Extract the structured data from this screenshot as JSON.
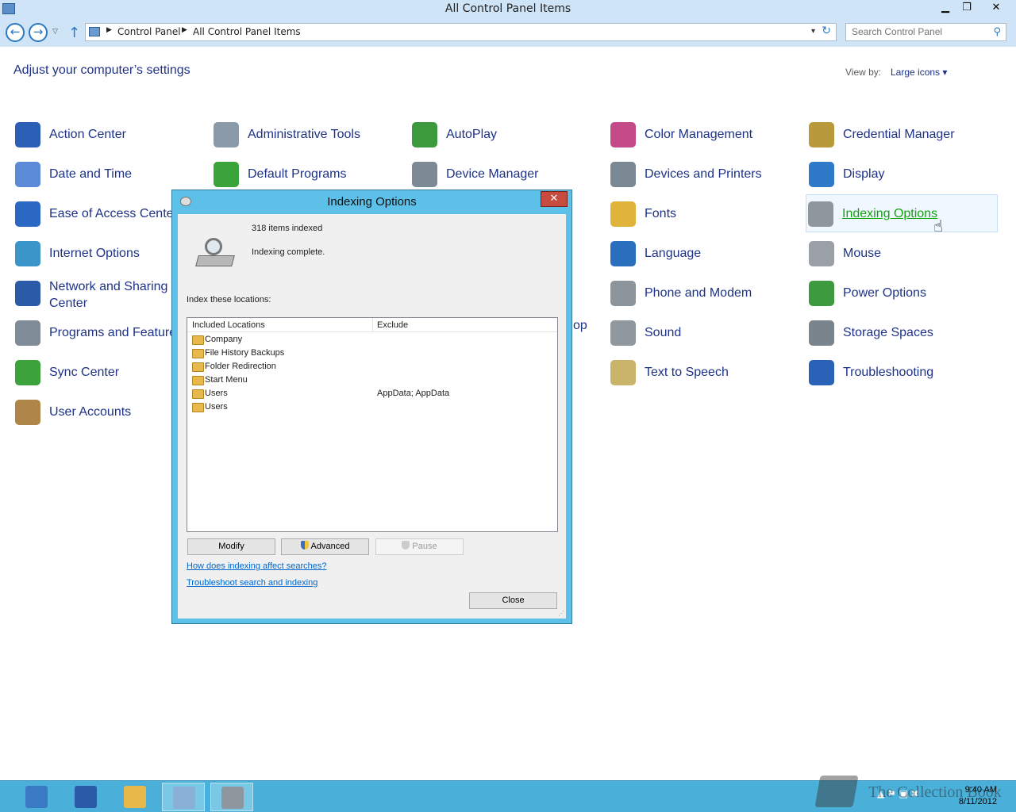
{
  "window": {
    "title": "All Control Panel Items",
    "min_glyph": "▁",
    "max_glyph": "❐",
    "close_glyph": "✕"
  },
  "nav": {
    "back_glyph": "←",
    "forward_glyph": "→",
    "recent_glyph": "▽",
    "up_glyph": "↑",
    "breadcrumb": [
      "Control Panel",
      "All Control Panel Items"
    ],
    "sep_glyph": "▶",
    "dropdown_glyph": "▾",
    "refresh_glyph": "↻",
    "search_placeholder": "Search Control Panel",
    "search_glyph": "⚲"
  },
  "header": {
    "title": "Adjust your computer’s settings",
    "view_by_label": "View by:",
    "view_by_value": "Large icons ▾"
  },
  "items": [
    {
      "label": "Action Center",
      "icon": "flag-icon",
      "color": "#2a5fb5"
    },
    {
      "label": "Administrative Tools",
      "icon": "gear-icon",
      "color": "#8a9aa8"
    },
    {
      "label": "AutoPlay",
      "icon": "autoplay-icon",
      "color": "#3c9a3c"
    },
    {
      "label": "Color Management",
      "icon": "color-icon",
      "color": "#c44a8a"
    },
    {
      "label": "Credential Manager",
      "icon": "vault-icon",
      "color": "#b89a3a"
    },
    {
      "label": "Date and Time",
      "icon": "calendar-icon",
      "color": "#5a8ad8"
    },
    {
      "label": "Default Programs",
      "icon": "default-programs-icon",
      "color": "#3aa33a"
    },
    {
      "label": "Device Manager",
      "icon": "device-manager-icon",
      "color": "#7d8a96"
    },
    {
      "label": "Devices and Printers",
      "icon": "printer-icon",
      "color": "#7a8894"
    },
    {
      "label": "Display",
      "icon": "monitor-icon",
      "color": "#2f79c9"
    },
    {
      "label": "Ease of Access Center",
      "icon": "accessibility-icon",
      "color": "#2a68c4"
    },
    {
      "label": "Fonts",
      "icon": "fonts-icon",
      "color": "#e0b33a"
    },
    {
      "label": "Indexing Options",
      "icon": "indexing-icon",
      "color": "#8e979e"
    },
    {
      "label": "Internet Options",
      "icon": "globe-icon",
      "color": "#3a95c9"
    },
    {
      "label": "Language",
      "icon": "language-icon",
      "color": "#2a6fbd"
    },
    {
      "label": "Mouse",
      "icon": "mouse-icon",
      "color": "#9aa0a6"
    },
    {
      "label": "Network and Sharing Center",
      "icon": "network-icon",
      "color": "#2a5aa8"
    },
    {
      "label": "Phone and Modem",
      "icon": "phone-icon",
      "color": "#8c959c"
    },
    {
      "label": "Power Options",
      "icon": "power-icon",
      "color": "#3e9a3e"
    },
    {
      "label": "Programs and Features",
      "icon": "programs-icon",
      "color": "#7f8c97"
    },
    {
      "label": "Sound",
      "icon": "speaker-icon",
      "color": "#8f989f"
    },
    {
      "label": "Storage Spaces",
      "icon": "storage-icon",
      "color": "#7a848c"
    },
    {
      "label": "Sync Center",
      "icon": "sync-icon",
      "color": "#3ca33c"
    },
    {
      "label": "Text to Speech",
      "icon": "speech-icon",
      "color": "#c9b46a"
    },
    {
      "label": "Troubleshooting",
      "icon": "troubleshoot-icon",
      "color": "#2a62b8"
    },
    {
      "label": "User Accounts",
      "icon": "users-icon",
      "color": "#b0854a"
    }
  ],
  "partial_label": "op",
  "dialog": {
    "title": "Indexing Options",
    "close_glyph": "✕",
    "count_text": "318 items indexed",
    "status_text": "Indexing complete.",
    "locations_label": "Index these locations:",
    "col_included": "Included Locations",
    "col_exclude": "Exclude",
    "rows": [
      {
        "name": "Company",
        "exclude": ""
      },
      {
        "name": "File History Backups",
        "exclude": ""
      },
      {
        "name": "Folder Redirection",
        "exclude": ""
      },
      {
        "name": "Start Menu",
        "exclude": ""
      },
      {
        "name": "Users",
        "exclude": "AppData; AppData"
      },
      {
        "name": "Users",
        "exclude": ""
      }
    ],
    "modify_label": "Modify",
    "advanced_label": "Advanced",
    "pause_label": "Pause",
    "link_help": "How does indexing affect searches?",
    "link_troubleshoot": "Troubleshoot search and indexing",
    "close_label": "Close"
  },
  "taskbar": {
    "buttons": [
      {
        "icon": "server-manager-icon",
        "color": "#3a7ac4"
      },
      {
        "icon": "powershell-icon",
        "color": "#2a5aa8"
      },
      {
        "icon": "file-explorer-icon",
        "color": "#e8b94a"
      },
      {
        "icon": "control-panel-icon",
        "color": "#8ab0d8"
      },
      {
        "icon": "indexing-icon",
        "color": "#aeb8c0"
      }
    ],
    "watermark": "The Collection Book",
    "time": "9:40 AM",
    "date": "8/11/2012"
  }
}
